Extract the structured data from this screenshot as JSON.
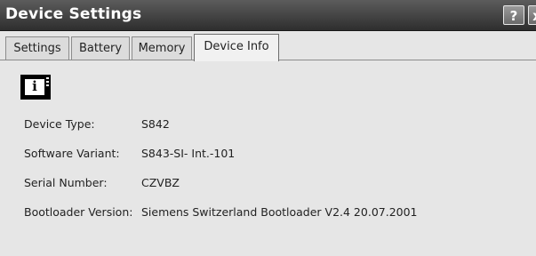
{
  "window": {
    "title": "Device Settings",
    "help_label": "?",
    "close_label": "x"
  },
  "tabs": [
    {
      "label": "Settings",
      "active": false
    },
    {
      "label": "Battery",
      "active": false
    },
    {
      "label": "Memory",
      "active": false
    },
    {
      "label": "Device Info",
      "active": true
    }
  ],
  "info": {
    "icon": "info-icon",
    "icon_glyph": "i",
    "rows": [
      {
        "label": "Device Type:",
        "value": "S842"
      },
      {
        "label": "Software Variant:",
        "value": "S843-SI- Int.-101"
      },
      {
        "label": "Serial Number:",
        "value": "CZVBZ"
      },
      {
        "label": "Bootloader Version:",
        "value": "Siemens Switzerland Bootloader V2.4 20.07.2001"
      }
    ]
  }
}
